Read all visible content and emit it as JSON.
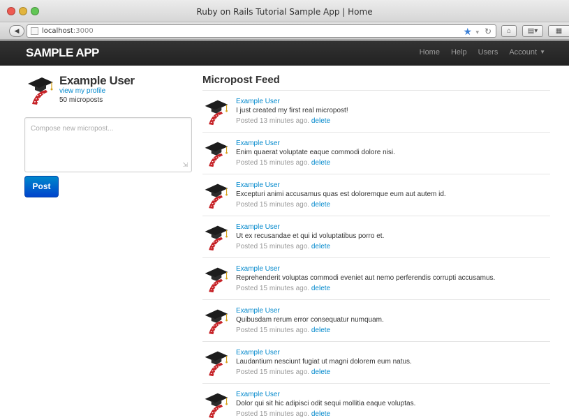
{
  "window": {
    "title": "Ruby on Rails Tutorial Sample App | Home",
    "url_host": "localhost",
    "url_port": ":3000"
  },
  "navbar": {
    "brand": "SAMPLE APP",
    "links": [
      "Home",
      "Help",
      "Users",
      "Account"
    ]
  },
  "user": {
    "name": "Example User",
    "profile_link": "view my profile",
    "post_count": "50 microposts"
  },
  "compose": {
    "placeholder": "Compose new micropost...",
    "post_label": "Post"
  },
  "feed": {
    "title": "Micropost Feed",
    "delete_label": "delete",
    "items": [
      {
        "user": "Example User",
        "content": "I just created my first real micropost!",
        "posted": "Posted 13 minutes ago."
      },
      {
        "user": "Example User",
        "content": "Enim quaerat voluptate eaque commodi dolore nisi.",
        "posted": "Posted 15 minutes ago."
      },
      {
        "user": "Example User",
        "content": "Excepturi animi accusamus quas est doloremque eum aut autem id.",
        "posted": "Posted 15 minutes ago."
      },
      {
        "user": "Example User",
        "content": "Ut ex recusandae et qui id voluptatibus porro et.",
        "posted": "Posted 15 minutes ago."
      },
      {
        "user": "Example User",
        "content": "Reprehenderit voluptas commodi eveniet aut nemo perferendis corrupti accusamus.",
        "posted": "Posted 15 minutes ago."
      },
      {
        "user": "Example User",
        "content": "Quibusdam rerum error consequatur numquam.",
        "posted": "Posted 15 minutes ago."
      },
      {
        "user": "Example User",
        "content": "Laudantium nesciunt fugiat ut magni dolorem eum natus.",
        "posted": "Posted 15 minutes ago."
      },
      {
        "user": "Example User",
        "content": "Dolor qui sit hic adipisci odit sequi mollitia eaque voluptas.",
        "posted": "Posted 15 minutes ago."
      }
    ]
  },
  "icons": {
    "avatar": "rails-graduate-avatar-icon",
    "back": "back-arrow-icon",
    "bookmark": "star-icon",
    "reload": "reload-icon",
    "home": "home-icon"
  }
}
